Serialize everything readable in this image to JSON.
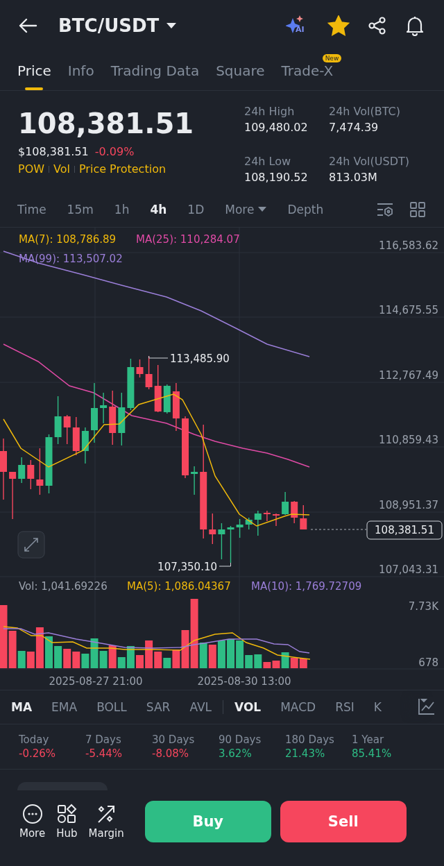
{
  "header": {
    "title": "BTC/USDT",
    "ai_label": "AI",
    "favorited": true
  },
  "tabs": [
    {
      "label": "Price",
      "selected": true
    },
    {
      "label": "Info",
      "selected": false
    },
    {
      "label": "Trading Data",
      "selected": false
    },
    {
      "label": "Square",
      "selected": false
    },
    {
      "label": "Trade-X",
      "selected": false,
      "badge": "New"
    }
  ],
  "price": {
    "last": "108,381.51",
    "usd": "$108,381.51",
    "change": {
      "text": "-0.09%",
      "color": "#f6465d"
    },
    "tags": [
      "POW",
      "Vol",
      "Price Protection"
    ],
    "stats": [
      {
        "label": "24h High",
        "value": "109,480.02"
      },
      {
        "label": "24h Vol(BTC)",
        "value": "7,474.39"
      },
      {
        "label": "24h Low",
        "value": "108,190.52"
      },
      {
        "label": "24h Vol(USDT)",
        "value": "813.03M"
      }
    ]
  },
  "intervals": [
    {
      "label": "Time",
      "kind": "plain",
      "selected": false
    },
    {
      "label": "15m",
      "kind": "plain",
      "selected": false
    },
    {
      "label": "1h",
      "kind": "plain",
      "selected": false
    },
    {
      "label": "4h",
      "kind": "plain",
      "selected": true
    },
    {
      "label": "1D",
      "kind": "plain",
      "selected": false
    },
    {
      "label": "More",
      "kind": "dropdown",
      "selected": false
    },
    {
      "label": "Depth",
      "kind": "plain",
      "selected": false
    }
  ],
  "chart": {
    "ma_legend": [
      {
        "text": "MA(7): 108,786.89",
        "color": "#f0b90b"
      },
      {
        "text": "MA(25): 110,284.07",
        "color": "#e04ba6"
      },
      {
        "text": "MA(99): 113,507.02",
        "color": "#9b7fd9"
      }
    ],
    "price_ticks": [
      "116,583.62",
      "114,675.55",
      "112,767.49",
      "110,859.43",
      "108,951.37",
      "107,043.31"
    ],
    "high_label": "113,485.90",
    "low_label": "107,350.10",
    "current_price": "108,381.51"
  },
  "volume": {
    "legend": [
      {
        "text": "Vol: 1,041.69226",
        "color": "#9ba2ad"
      },
      {
        "text": "MA(5): 1,086.04367",
        "color": "#f0b90b"
      },
      {
        "text": "MA(10): 1,769.72709",
        "color": "#9b7fd9"
      }
    ],
    "ticks": [
      "7.73K",
      "678"
    ],
    "dates": [
      "2025-08-27 21:00",
      "2025-08-30 13:00"
    ]
  },
  "indicators": [
    {
      "label": "MA",
      "selected": true,
      "divider_before": false
    },
    {
      "label": "EMA",
      "selected": false,
      "divider_before": false
    },
    {
      "label": "BOLL",
      "selected": false,
      "divider_before": false
    },
    {
      "label": "SAR",
      "selected": false,
      "divider_before": false
    },
    {
      "label": "AVL",
      "selected": false,
      "divider_before": false
    },
    {
      "label": "VOL",
      "selected": true,
      "divider_before": true
    },
    {
      "label": "MACD",
      "selected": false,
      "divider_before": false
    },
    {
      "label": "RSI",
      "selected": false,
      "divider_before": false
    },
    {
      "label": "K",
      "selected": false,
      "divider_before": false
    }
  ],
  "performance": [
    {
      "label": "Today",
      "value": "-0.26%",
      "color": "#f6465d"
    },
    {
      "label": "7 Days",
      "value": "-5.44%",
      "color": "#f6465d"
    },
    {
      "label": "30 Days",
      "value": "-8.08%",
      "color": "#f6465d"
    },
    {
      "label": "90 Days",
      "value": "3.62%",
      "color": "#2ebd85"
    },
    {
      "label": "180 Days",
      "value": "21.43%",
      "color": "#2ebd85"
    },
    {
      "label": "1 Year",
      "value": "85.41%",
      "color": "#2ebd85"
    }
  ],
  "bottom": {
    "actions": [
      {
        "label": "More",
        "kind": "more"
      },
      {
        "label": "Hub",
        "kind": "hub"
      },
      {
        "label": "Margin",
        "kind": "margin"
      }
    ],
    "buy": "Buy",
    "sell": "Sell"
  }
}
